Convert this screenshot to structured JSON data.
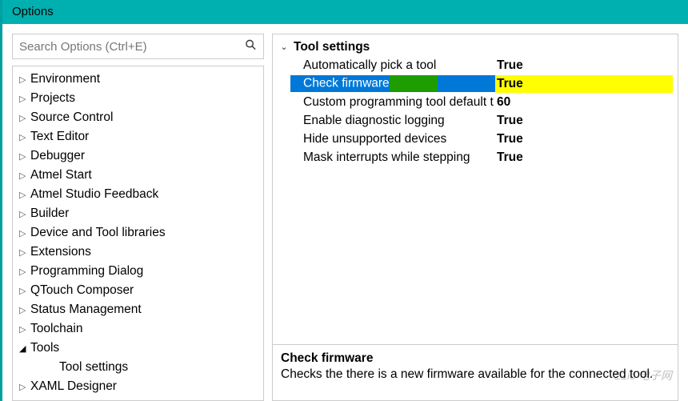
{
  "window": {
    "title": "Options"
  },
  "search": {
    "placeholder": "Search Options (Ctrl+E)"
  },
  "tree": {
    "items": [
      {
        "label": "Environment",
        "expanded": false,
        "level": 0
      },
      {
        "label": "Projects",
        "expanded": false,
        "level": 0
      },
      {
        "label": "Source Control",
        "expanded": false,
        "level": 0
      },
      {
        "label": "Text Editor",
        "expanded": false,
        "level": 0
      },
      {
        "label": "Debugger",
        "expanded": false,
        "level": 0
      },
      {
        "label": "Atmel Start",
        "expanded": false,
        "level": 0
      },
      {
        "label": "Atmel Studio Feedback",
        "expanded": false,
        "level": 0
      },
      {
        "label": "Builder",
        "expanded": false,
        "level": 0
      },
      {
        "label": "Device and Tool libraries",
        "expanded": false,
        "level": 0
      },
      {
        "label": "Extensions",
        "expanded": false,
        "level": 0
      },
      {
        "label": "Programming Dialog",
        "expanded": false,
        "level": 0
      },
      {
        "label": "QTouch Composer",
        "expanded": false,
        "level": 0
      },
      {
        "label": "Status Management",
        "expanded": false,
        "level": 0
      },
      {
        "label": "Toolchain",
        "expanded": false,
        "level": 0
      },
      {
        "label": "Tools",
        "expanded": true,
        "level": 0
      },
      {
        "label": "Tool settings",
        "expanded": null,
        "level": 1
      },
      {
        "label": "XAML Designer",
        "expanded": false,
        "level": 0
      }
    ]
  },
  "properties": {
    "category": "Tool settings",
    "rows": [
      {
        "label": "Automatically pick a tool",
        "value": "True",
        "selected": false
      },
      {
        "label": "Check firmware",
        "value": "True",
        "selected": true,
        "highlight": true
      },
      {
        "label": "Custom programming tool default t",
        "value": "60",
        "selected": false
      },
      {
        "label": "Enable diagnostic logging",
        "value": "True",
        "selected": false
      },
      {
        "label": "Hide unsupported devices",
        "value": "True",
        "selected": false
      },
      {
        "label": "Mask interrupts while stepping",
        "value": "True",
        "selected": false
      }
    ]
  },
  "description": {
    "title": "Check firmware",
    "body": "Checks the there is a new firmware available for the connected tool."
  },
  "arrows": {
    "collapsed": "▷",
    "expanded": "◢",
    "cat": "⌄"
  }
}
